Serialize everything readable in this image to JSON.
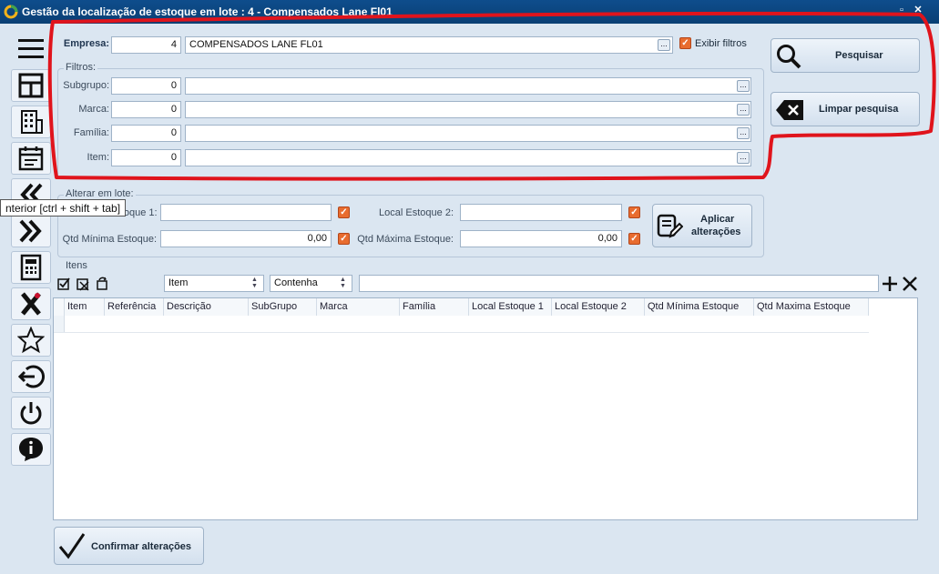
{
  "window": {
    "title": "Gestão da localização de estoque em lote : 4 - Compensados Lane Fl01"
  },
  "sidebar": {
    "tooltip": "nterior [ctrl + shift + tab]",
    "buttons": [
      {
        "icon": "hamburger-menu-icon"
      },
      {
        "icon": "layout-icon"
      },
      {
        "icon": "building-icon"
      },
      {
        "icon": "calendar-icon"
      },
      {
        "icon": "previous-icon"
      },
      {
        "icon": "next-icon"
      },
      {
        "icon": "calculator-icon"
      },
      {
        "icon": "tools-icon"
      },
      {
        "icon": "star-icon"
      },
      {
        "icon": "logout-icon"
      },
      {
        "icon": "power-icon"
      },
      {
        "icon": "info-icon"
      }
    ]
  },
  "empresa": {
    "label": "Empresa:",
    "code": "4",
    "name": "COMPENSADOS LANE FL01",
    "lookup": "...",
    "show_filters_label": "Exibir filtros",
    "show_filters_checked": true
  },
  "filtros": {
    "legend": "Filtros:",
    "rows": [
      {
        "label": "Subgrupo:",
        "code": "0",
        "desc": "",
        "lookup": "..."
      },
      {
        "label": "Marca:",
        "code": "0",
        "desc": "",
        "lookup": "..."
      },
      {
        "label": "Família:",
        "code": "0",
        "desc": "",
        "lookup": "..."
      },
      {
        "label": "Item:",
        "code": "0",
        "desc": "",
        "lookup": "..."
      }
    ]
  },
  "actions": {
    "search_label": "Pesquisar",
    "clear_label": "Limpar pesquisa"
  },
  "alterar": {
    "legend": "Alterar em lote:",
    "local1_label": "Estoque 1:",
    "local1_value": "",
    "local2_label": "Local Estoque 2:",
    "local2_value": "",
    "qtd_min_label": "Qtd Mínima Estoque:",
    "qtd_min_value": "0,00",
    "qtd_max_label": "Qtd Máxima Estoque:",
    "qtd_max_value": "0,00",
    "apply_line1": "Aplicar",
    "apply_line2": "alterações"
  },
  "itens": {
    "legend": "Itens",
    "filter_field": "Item",
    "filter_op": "Contenha",
    "filter_value": "",
    "columns": [
      "Item",
      "Referência",
      "Descrição",
      "SubGrupo",
      "Marca",
      "Família",
      "Local Estoque 1",
      "Local Estoque 2",
      "Qtd Mínima Estoque",
      "Qtd Maxima Estoque"
    ]
  },
  "footer": {
    "confirm_label": "Confirmar alterações"
  },
  "colors": {
    "titlebar": "#0a3f74",
    "background": "#dbe6f1",
    "checkbox": "#e86c2f",
    "annotation": "#e0141c"
  }
}
